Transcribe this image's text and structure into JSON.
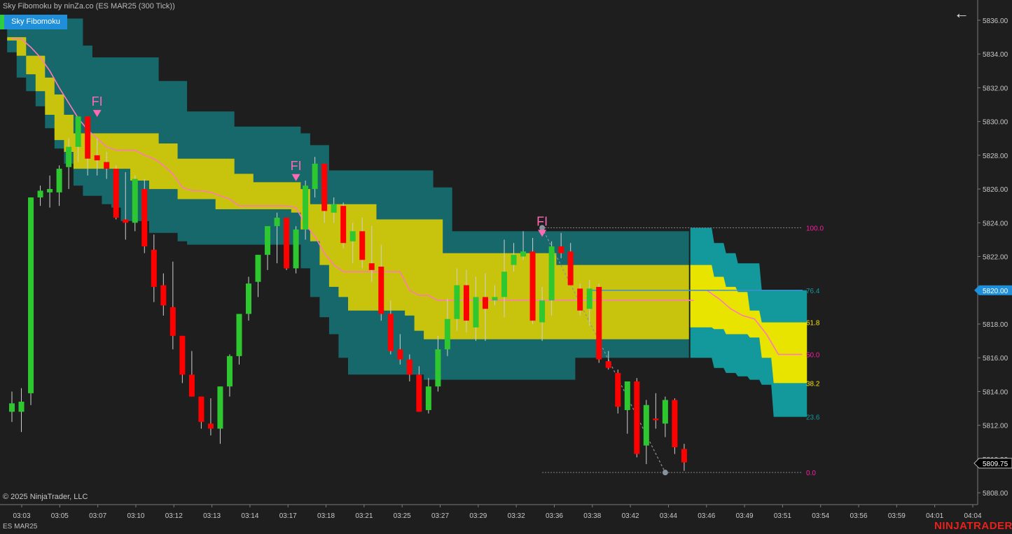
{
  "window": {
    "title": "Sky Fibomoku by ninZa.co (ES MAR25 (300 Tick))",
    "indicator_badge": "Sky Fibomoku",
    "copyright": "© 2025 NinjaTrader, LLC",
    "instrument": "ES MAR25",
    "brand": "NINJATRADER",
    "back_icon": "arrow-left-icon"
  },
  "colors": {
    "background": "#1e1e1e",
    "up_candle": "#2fc72f",
    "down_candle": "#ff0000",
    "outer_band": "#17686b",
    "inner_band": "#c8c30c",
    "outer_band_projection": "#13989c",
    "inner_band_projection": "#e8e400",
    "midline": "#ff7ab6",
    "signal": "#ff69b4",
    "axis_text": "#c8c8c8",
    "current_price_tag": "#1e8fd8"
  },
  "chart_data": {
    "type": "candlestick",
    "title": "Sky Fibomoku by ninZa.co (ES MAR25 (300 Tick))",
    "xlabel": "",
    "ylabel": "",
    "ylim": [
      5807.3,
      5837.2
    ],
    "y_ticks": [
      {
        "value": 5836.0,
        "label": "5836.00"
      },
      {
        "value": 5834.0,
        "label": "5834.00"
      },
      {
        "value": 5832.0,
        "label": "5832.00"
      },
      {
        "value": 5830.0,
        "label": "5830.00"
      },
      {
        "value": 5828.0,
        "label": "5828.00"
      },
      {
        "value": 5826.0,
        "label": "5826.00"
      },
      {
        "value": 5824.0,
        "label": "5824.00"
      },
      {
        "value": 5822.0,
        "label": "5822.00"
      },
      {
        "value": 5820.0,
        "label": "5820.00"
      },
      {
        "value": 5818.0,
        "label": "5818.00"
      },
      {
        "value": 5816.0,
        "label": "5816.00"
      },
      {
        "value": 5814.0,
        "label": "5814.00"
      },
      {
        "value": 5812.0,
        "label": "5812.00"
      },
      {
        "value": 5810.0,
        "label": "5810.00"
      },
      {
        "value": 5808.0,
        "label": "5808.00"
      }
    ],
    "x_ticks": [
      "03:03",
      "03:05",
      "03:07",
      "03:10",
      "03:12",
      "03:13",
      "03:14",
      "03:17",
      "03:18",
      "03:21",
      "03:25",
      "03:27",
      "03:29",
      "03:32",
      "03:36",
      "03:38",
      "03:42",
      "03:44",
      "03:46",
      "03:49",
      "03:51",
      "03:54",
      "03:56",
      "03:59",
      "04:01",
      "04:04"
    ],
    "x_range": [
      0,
      100
    ],
    "candles": [
      {
        "o": 5812.8,
        "h": 5814.0,
        "l": 5812.2,
        "c": 5813.3
      },
      {
        "o": 5812.8,
        "h": 5814.2,
        "l": 5811.6,
        "c": 5813.4
      },
      {
        "o": 5813.9,
        "h": 5825.5,
        "l": 5813.2,
        "c": 5825.5
      },
      {
        "o": 5825.5,
        "h": 5826.2,
        "l": 5825.0,
        "c": 5825.9
      },
      {
        "o": 5825.8,
        "h": 5826.8,
        "l": 5824.9,
        "c": 5826.0
      },
      {
        "o": 5825.8,
        "h": 5827.4,
        "l": 5825.0,
        "c": 5827.2
      },
      {
        "o": 5827.3,
        "h": 5829.0,
        "l": 5826.0,
        "c": 5828.5
      },
      {
        "o": 5828.5,
        "h": 5830.3,
        "l": 5827.6,
        "c": 5830.3
      },
      {
        "o": 5830.3,
        "h": 5830.3,
        "l": 5826.8,
        "c": 5827.8
      },
      {
        "o": 5828.0,
        "h": 5829.0,
        "l": 5826.8,
        "c": 5827.7
      },
      {
        "o": 5827.6,
        "h": 5828.2,
        "l": 5826.6,
        "c": 5827.2
      },
      {
        "o": 5827.2,
        "h": 5827.4,
        "l": 5824.2,
        "c": 5824.3
      },
      {
        "o": 5824.2,
        "h": 5827.0,
        "l": 5823.0,
        "c": 5824.0
      },
      {
        "o": 5824.0,
        "h": 5826.8,
        "l": 5823.5,
        "c": 5826.6
      },
      {
        "o": 5826.0,
        "h": 5826.6,
        "l": 5822.2,
        "c": 5822.6
      },
      {
        "o": 5822.4,
        "h": 5823.3,
        "l": 5819.3,
        "c": 5820.2
      },
      {
        "o": 5820.3,
        "h": 5821.0,
        "l": 5818.5,
        "c": 5819.1
      },
      {
        "o": 5819.0,
        "h": 5821.7,
        "l": 5816.5,
        "c": 5817.3
      },
      {
        "o": 5817.3,
        "h": 5817.3,
        "l": 5814.5,
        "c": 5815.0
      },
      {
        "o": 5815.0,
        "h": 5816.4,
        "l": 5813.7,
        "c": 5813.7
      },
      {
        "o": 5813.7,
        "h": 5813.7,
        "l": 5811.8,
        "c": 5812.2
      },
      {
        "o": 5812.1,
        "h": 5813.6,
        "l": 5811.4,
        "c": 5811.8
      },
      {
        "o": 5811.8,
        "h": 5814.3,
        "l": 5810.9,
        "c": 5814.3
      },
      {
        "o": 5814.3,
        "h": 5816.2,
        "l": 5813.7,
        "c": 5816.1
      },
      {
        "o": 5816.1,
        "h": 5818.6,
        "l": 5815.6,
        "c": 5818.6
      },
      {
        "o": 5818.6,
        "h": 5820.8,
        "l": 5818.2,
        "c": 5820.4
      },
      {
        "o": 5820.5,
        "h": 5822.1,
        "l": 5819.6,
        "c": 5822.1
      },
      {
        "o": 5822.1,
        "h": 5823.8,
        "l": 5821.2,
        "c": 5823.8
      },
      {
        "o": 5823.8,
        "h": 5824.6,
        "l": 5821.6,
        "c": 5824.3
      },
      {
        "o": 5824.3,
        "h": 5824.3,
        "l": 5821.2,
        "c": 5821.3
      },
      {
        "o": 5821.3,
        "h": 5823.8,
        "l": 5821.0,
        "c": 5823.6
      },
      {
        "o": 5823.6,
        "h": 5826.5,
        "l": 5823.0,
        "c": 5826.2
      },
      {
        "o": 5826.0,
        "h": 5827.9,
        "l": 5825.5,
        "c": 5827.5
      },
      {
        "o": 5827.5,
        "h": 5827.5,
        "l": 5824.0,
        "c": 5824.7
      },
      {
        "o": 5824.6,
        "h": 5825.5,
        "l": 5824.0,
        "c": 5825.1
      },
      {
        "o": 5825.0,
        "h": 5825.2,
        "l": 5822.5,
        "c": 5822.8
      },
      {
        "o": 5822.9,
        "h": 5824.0,
        "l": 5821.6,
        "c": 5823.5
      },
      {
        "o": 5823.5,
        "h": 5824.3,
        "l": 5821.3,
        "c": 5821.8
      },
      {
        "o": 5821.6,
        "h": 5823.8,
        "l": 5820.5,
        "c": 5821.2
      },
      {
        "o": 5821.4,
        "h": 5822.7,
        "l": 5818.2,
        "c": 5818.6
      },
      {
        "o": 5818.6,
        "h": 5819.4,
        "l": 5816.2,
        "c": 5816.4
      },
      {
        "o": 5816.5,
        "h": 5817.4,
        "l": 5815.6,
        "c": 5815.9
      },
      {
        "o": 5815.9,
        "h": 5816.2,
        "l": 5814.6,
        "c": 5815.0
      },
      {
        "o": 5815.0,
        "h": 5815.5,
        "l": 5812.8,
        "c": 5812.8
      },
      {
        "o": 5812.9,
        "h": 5814.8,
        "l": 5812.7,
        "c": 5814.3
      },
      {
        "o": 5814.3,
        "h": 5817.3,
        "l": 5814.0,
        "c": 5816.5
      },
      {
        "o": 5816.5,
        "h": 5819.5,
        "l": 5816.1,
        "c": 5818.3
      },
      {
        "o": 5818.3,
        "h": 5821.3,
        "l": 5817.6,
        "c": 5820.3
      },
      {
        "o": 5820.3,
        "h": 5821.2,
        "l": 5817.5,
        "c": 5818.2
      },
      {
        "o": 5817.8,
        "h": 5820.8,
        "l": 5817.0,
        "c": 5819.6
      },
      {
        "o": 5819.6,
        "h": 5821.0,
        "l": 5817.0,
        "c": 5818.9
      },
      {
        "o": 5819.4,
        "h": 5820.3,
        "l": 5819.1,
        "c": 5819.6
      },
      {
        "o": 5819.6,
        "h": 5823.0,
        "l": 5818.4,
        "c": 5821.1
      },
      {
        "o": 5821.5,
        "h": 5822.8,
        "l": 5821.1,
        "c": 5822.1
      },
      {
        "o": 5822.0,
        "h": 5823.5,
        "l": 5821.8,
        "c": 5822.3
      },
      {
        "o": 5822.3,
        "h": 5823.1,
        "l": 5818.0,
        "c": 5818.2
      },
      {
        "o": 5818.1,
        "h": 5820.2,
        "l": 5817.0,
        "c": 5819.4
      },
      {
        "o": 5819.4,
        "h": 5822.9,
        "l": 5818.5,
        "c": 5822.6
      },
      {
        "o": 5822.6,
        "h": 5823.4,
        "l": 5821.9,
        "c": 5822.2
      },
      {
        "o": 5822.3,
        "h": 5822.8,
        "l": 5820.3,
        "c": 5820.3
      },
      {
        "o": 5820.1,
        "h": 5820.4,
        "l": 5818.5,
        "c": 5818.8
      },
      {
        "o": 5818.9,
        "h": 5820.6,
        "l": 5817.9,
        "c": 5820.1
      },
      {
        "o": 5820.2,
        "h": 5820.4,
        "l": 5815.7,
        "c": 5815.9
      },
      {
        "o": 5815.8,
        "h": 5816.4,
        "l": 5815.3,
        "c": 5815.4
      },
      {
        "o": 5815.1,
        "h": 5815.3,
        "l": 5812.7,
        "c": 5813.1
      },
      {
        "o": 5812.9,
        "h": 5814.6,
        "l": 5811.5,
        "c": 5814.6
      },
      {
        "o": 5814.6,
        "h": 5814.8,
        "l": 5810.1,
        "c": 5810.3
      },
      {
        "o": 5810.8,
        "h": 5813.5,
        "l": 5809.7,
        "c": 5813.2
      },
      {
        "o": 5812.4,
        "h": 5813.9,
        "l": 5811.8,
        "c": 5812.3
      },
      {
        "o": 5812.1,
        "h": 5813.7,
        "l": 5811.3,
        "c": 5813.5
      },
      {
        "o": 5813.5,
        "h": 5813.6,
        "l": 5810.3,
        "c": 5810.7
      },
      {
        "o": 5810.6,
        "h": 5810.9,
        "l": 5809.3,
        "c": 5809.8
      }
    ],
    "bands": {
      "outer_upper": [
        5836.1,
        5836.1,
        5836.1,
        5836.1,
        5836.1,
        5836.1,
        5836.1,
        5836.1,
        5834.5,
        5833.8,
        5833.8,
        5833.8,
        5833.8,
        5833.8,
        5833.8,
        5833.8,
        5832.4,
        5832.4,
        5832.4,
        5830.6,
        5830.6,
        5830.6,
        5830.6,
        5830.6,
        5829.7,
        5829.7,
        5829.7,
        5829.7,
        5829.7,
        5829.7,
        5829.7,
        5829.3,
        5828.6,
        5828.6,
        5827.1,
        5827.1,
        5827.1,
        5827.1,
        5827.1,
        5827.1,
        5827.1,
        5827.1,
        5827.1,
        5827.1,
        5827.1,
        5826.1,
        5826.1,
        5823.5,
        5823.5,
        5823.5,
        5823.5,
        5823.5,
        5823.5,
        5823.5,
        5823.5,
        5823.5,
        5823.5,
        5823.5,
        5823.5,
        5823.5,
        5823.5,
        5823.5,
        5823.5,
        5823.5,
        5823.5,
        5823.5,
        5823.5,
        5823.5,
        5823.5,
        5823.5,
        5823.5,
        5823.5,
        5823.5
      ],
      "inner_upper": [
        5835.0,
        5835.0,
        5833.9,
        5833.9,
        5832.6,
        5831.6,
        5830.4,
        5829.3,
        5829.3,
        5829.3,
        5829.3,
        5829.3,
        5829.3,
        5829.3,
        5829.3,
        5829.3,
        5828.7,
        5828.7,
        5827.8,
        5827.8,
        5827.8,
        5827.8,
        5827.8,
        5827.8,
        5826.9,
        5826.9,
        5826.4,
        5826.4,
        5826.4,
        5826.4,
        5826.4,
        5826.0,
        5825.1,
        5825.1,
        5825.1,
        5825.1,
        5825.1,
        5825.1,
        5825.1,
        5824.2,
        5824.2,
        5824.2,
        5824.2,
        5824.2,
        5824.2,
        5824.2,
        5822.2,
        5822.2,
        5822.2,
        5822.2,
        5822.2,
        5822.2,
        5822.2,
        5822.2,
        5822.2,
        5822.2,
        5822.2,
        5822.2,
        5821.5,
        5821.5,
        5821.5,
        5821.5,
        5821.5,
        5821.5,
        5821.5,
        5821.5,
        5821.5,
        5821.5,
        5821.5,
        5821.5,
        5821.5,
        5821.5,
        5821.5
      ],
      "midline": [
        5834.9,
        5834.9,
        5834.4,
        5833.8,
        5833.0,
        5832.0,
        5831.1,
        5830.2,
        5829.5,
        5829.0,
        5828.5,
        5828.3,
        5828.3,
        5828.3,
        5828.0,
        5827.8,
        5827.4,
        5826.9,
        5826.1,
        5825.9,
        5825.9,
        5825.8,
        5825.6,
        5825.4,
        5825.0,
        5825.0,
        5825.0,
        5825.0,
        5825.0,
        5825.0,
        5824.9,
        5823.9,
        5823.2,
        5822.2,
        5821.5,
        5821.1,
        5821.1,
        5821.1,
        5821.1,
        5821.1,
        5821.1,
        5821.1,
        5820.0,
        5819.7,
        5819.7,
        5819.4,
        5819.4,
        5819.4,
        5819.4,
        5819.4,
        5819.4,
        5819.4,
        5819.4,
        5819.4,
        5819.4,
        5819.4,
        5819.4,
        5819.4,
        5819.4,
        5819.4,
        5819.4,
        5819.4,
        5819.4,
        5819.4,
        5819.4,
        5819.4,
        5819.4,
        5819.4,
        5819.4,
        5819.4,
        5819.4,
        5819.4,
        5819.4
      ],
      "inner_lower": [
        5834.8,
        5833.9,
        5832.8,
        5831.8,
        5830.4,
        5828.9,
        5828.2,
        5827.2,
        5827.2,
        5827.2,
        5827.2,
        5827.2,
        5827.2,
        5826.5,
        5826.5,
        5826.0,
        5826.0,
        5826.0,
        5825.4,
        5825.4,
        5825.4,
        5825.4,
        5824.8,
        5824.8,
        5824.8,
        5824.8,
        5824.8,
        5824.8,
        5824.8,
        5824.8,
        5824.6,
        5823.6,
        5822.9,
        5821.5,
        5820.2,
        5819.6,
        5818.8,
        5818.8,
        5818.8,
        5818.8,
        5818.8,
        5818.8,
        5818.5,
        5817.6,
        5817.1,
        5817.1,
        5817.1,
        5817.1,
        5817.1,
        5817.1,
        5817.1,
        5817.1,
        5817.1,
        5817.1,
        5817.1,
        5817.1,
        5817.1,
        5817.1,
        5817.1,
        5817.1,
        5817.1,
        5817.1,
        5817.1,
        5817.1,
        5817.1,
        5817.1,
        5817.1,
        5817.1,
        5817.1,
        5817.1,
        5817.1,
        5817.1,
        5817.1
      ],
      "outer_lower": [
        5834.1,
        5832.6,
        5831.8,
        5830.9,
        5829.6,
        5828.4,
        5827.5,
        5826.2,
        5825.6,
        5825.6,
        5825.1,
        5824.9,
        5824.1,
        5824.1,
        5824.1,
        5823.4,
        5823.4,
        5823.4,
        5822.9,
        5822.7,
        5822.7,
        5822.7,
        5822.7,
        5822.7,
        5822.7,
        5822.7,
        5822.7,
        5822.7,
        5822.7,
        5822.7,
        5822.7,
        5821.3,
        5819.6,
        5818.4,
        5817.4,
        5816.0,
        5815.0,
        5815.0,
        5815.0,
        5815.0,
        5815.0,
        5815.0,
        5815.0,
        5815.0,
        5814.7,
        5814.7,
        5814.7,
        5814.7,
        5814.7,
        5814.7,
        5814.7,
        5814.7,
        5814.7,
        5814.7,
        5814.7,
        5814.7,
        5814.7,
        5814.7,
        5814.7,
        5814.7,
        5816.0,
        5816.0,
        5816.0,
        5816.0,
        5816.0,
        5816.0,
        5816.0,
        5816.0,
        5816.0,
        5816.0,
        5816.0,
        5816.0,
        5816.0
      ],
      "projection": {
        "outer_upper": [
          5823.7,
          5823.7,
          5822.8,
          5822.2,
          5821.6,
          5821.6,
          5820.0,
          5820.0,
          5820.0,
          5820.0
        ],
        "inner_upper": [
          5821.5,
          5821.5,
          5820.8,
          5820.2,
          5819.9,
          5818.8,
          5818.1,
          5818.1,
          5818.1,
          5818.1
        ],
        "midline": [
          5820.0,
          5820.0,
          5819.5,
          5818.9,
          5818.5,
          5818.3,
          5817.4,
          5816.2,
          5816.2,
          5816.2
        ],
        "inner_lower": [
          5817.8,
          5817.8,
          5817.7,
          5817.4,
          5817.4,
          5817.2,
          5816.0,
          5814.5,
          5814.5,
          5814.5
        ],
        "outer_lower": [
          5816.0,
          5816.0,
          5815.4,
          5815.1,
          5814.9,
          5814.7,
          5814.4,
          5812.5,
          5812.5,
          5812.5
        ]
      }
    },
    "fib_levels": [
      {
        "label": "100.0",
        "value": 5823.7,
        "color": "#ff1aa0"
      },
      {
        "label": "76.4",
        "value": 5820.0,
        "color": "#13989c"
      },
      {
        "label": "61.8",
        "value": 5818.1,
        "color": "#f3e300"
      },
      {
        "label": "50.0",
        "value": 5816.2,
        "color": "#ff1aa0"
      },
      {
        "label": "38.2",
        "value": 5814.5,
        "color": "#f3e300"
      },
      {
        "label": "23.6",
        "value": 5812.5,
        "color": "#13989c"
      },
      {
        "label": "0.0",
        "value": 5809.2,
        "color": "#ff1aa0"
      }
    ],
    "signals": [
      {
        "label": "FI",
        "candle_index": 9,
        "value": 5830.6
      },
      {
        "label": "FI",
        "candle_index": 30,
        "value": 5826.8
      },
      {
        "label": "FI",
        "candle_index": 56,
        "value": 5823.5
      }
    ],
    "zigzag": {
      "start_index": 56,
      "start_value": 5823.7,
      "end_index": 69,
      "end_value": 5809.2
    },
    "last_price_label": "5809.75",
    "current_price_label": "5820.00",
    "current_price": 5820.0,
    "last_price": 5809.75
  }
}
